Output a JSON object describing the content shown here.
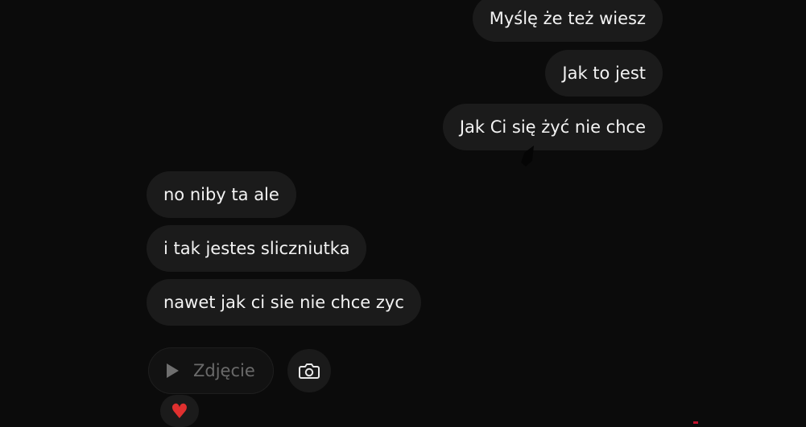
{
  "messages": {
    "sent": [
      "Myślę że też wiesz",
      "Jak to jest",
      "Jak Ci się żyć nie chce"
    ],
    "received": [
      "no niby ta ale",
      "i tak jestes sliczniutka",
      "nawet jak ci sie nie chce zyc"
    ]
  },
  "media": {
    "photo_label": "Zdjęcie",
    "play_icon": "play-icon",
    "camera_icon": "camera-icon"
  },
  "reaction": {
    "emoji": "♥",
    "icon": "heart-icon",
    "color": "#e0302f"
  },
  "colors": {
    "background": "#0b0b0b",
    "bubble": "#1b1b1b",
    "text": "#f3f3f3"
  }
}
